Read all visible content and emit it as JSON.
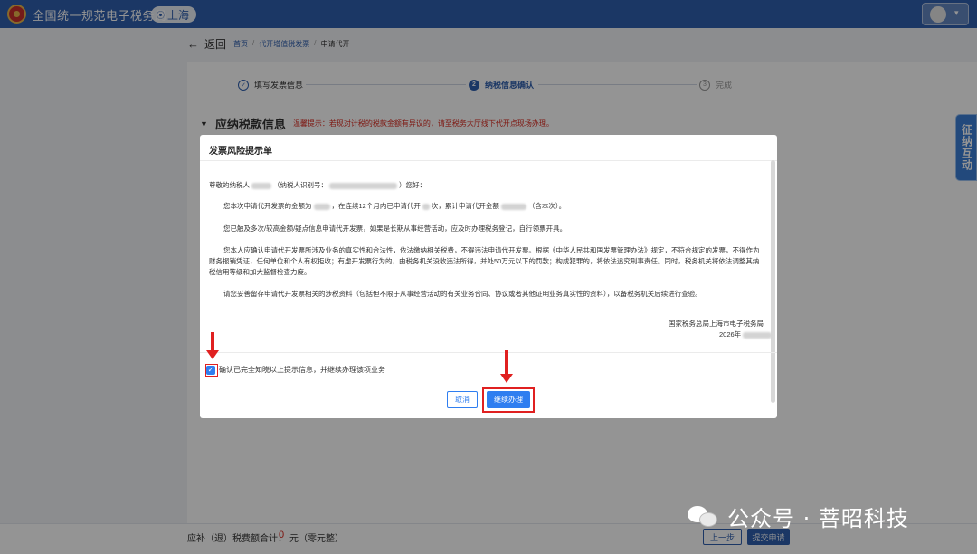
{
  "header": {
    "site_title": "全国统一规范电子税务局",
    "region": "上海"
  },
  "nav": {
    "back_label": "返回",
    "breadcrumb": [
      "首页",
      "代开增值税发票",
      "申请代开"
    ]
  },
  "steps": [
    {
      "num": "✓",
      "label": "填写发票信息",
      "state": "done"
    },
    {
      "num": "2",
      "label": "纳税信息确认",
      "state": "active"
    },
    {
      "num": "3",
      "label": "完成",
      "state": "todo"
    }
  ],
  "section": {
    "title": "应纳税款信息",
    "tip": "温馨提示：若现对计税的税款金额有异议的，请至税务大厅线下代开点现场办理。"
  },
  "side_button": {
    "label": "征纳互动"
  },
  "bottom": {
    "total_label": "应补（退）税费额合计：",
    "total_amount": "0",
    "total_unit": "元（零元整）",
    "prev_label": "上一步",
    "submit_label": "提交申请"
  },
  "modal": {
    "title": "发票风险提示单",
    "greeting_prefix": "尊敬的纳税人",
    "greeting_mid": "（纳税人识别号：",
    "greeting_suffix": "）您好：",
    "para1_a": "您本次申请代开发票的金额为",
    "para1_b": "，在连续12个月内已申请代开",
    "para1_c": "次，累计申请代开金额",
    "para1_d": "（含本次）。",
    "para2": "您已触及多次/较高金额/疑点信息申请代开发票，如果是长期从事经营活动，应及时办理税务登记，自行领票开具。",
    "para3": "您本人应确认申请代开发票所涉及业务的真实性和合法性，依法缴纳相关税费，不得违法申请代开发票。根据《中华人民共和国发票管理办法》规定，不符合规定的发票，不得作为财务报销凭证，任何单位和个人有权拒收；有虚开发票行为的，由税务机关没收违法所得，并处50万元以下的罚款；构成犯罪的，将依法追究刑事责任。同时，税务机关将依法调整其纳税信用等级和加大监督检查力度。",
    "para4": "请您妥善留存申请代开发票相关的涉税资料（包括但不限于从事经营活动的有关业务合同、协议或者其他证明业务真实性的资料），以备税务机关后续进行查验。",
    "signature": "国家税务总局上海市电子税务局",
    "date_prefix": "2026年",
    "check_label": "确认已完全知晓以上提示信息，并继续办理该项业务",
    "cancel_label": "取消",
    "continue_label": "继续办理"
  },
  "watermark": {
    "text": "公众号 · 菩昭科技"
  }
}
